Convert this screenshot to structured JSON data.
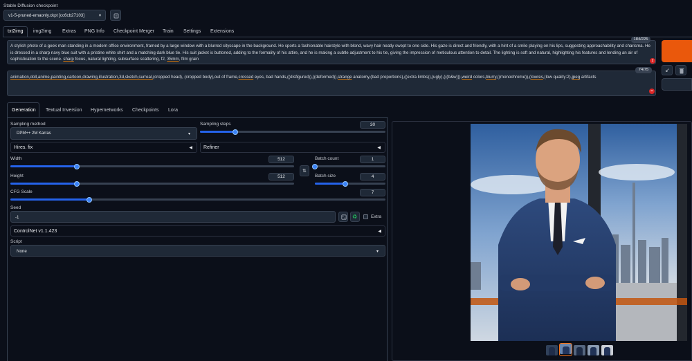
{
  "checkpoint": {
    "label": "Stable Diffusion checkpoint",
    "value": "v1-5-pruned-emaonly.ckpt [cc6cb27103]"
  },
  "tabs": [
    "txt2img",
    "img2img",
    "Extras",
    "PNG Info",
    "Checkpoint Merger",
    "Train",
    "Settings",
    "Extensions"
  ],
  "prompt": {
    "text_parts": [
      {
        "t": "A stylish photo of a geek man standing in a modern office environment, framed by a large window with a blurred cityscape in the background. He sports a fashionable hairstyle with blond, wavy hair neatly swept to one side. His gaze is direct and friendly, with a hint of a smile playing on his lips, suggesting approachability and charisma. He is dressed in a sharp navy blue suit with a pristine white shirt and a matching dark blue tie. His suit jacket is buttoned, adding to the formality of his attire, and he is making a subtle adjustment to his tie, giving the impression of meticulous attention to detail. The lighting is soft and natural, highlighting his features and lending an air of sophistication to the scene. ",
        "u": false
      },
      {
        "t": "sharp",
        "u": true
      },
      {
        "t": " focus, natural lighting, subsurface scattering, f2, ",
        "u": false
      },
      {
        "t": "35mm",
        "u": true
      },
      {
        "t": ", film grain",
        "u": false
      }
    ],
    "token_count": "184/225",
    "badge": "2"
  },
  "negative_prompt": {
    "text_parts": [
      {
        "t": "animation,doll,anime,painting,cartoon,drawing,illustration,3d,sketch,surreal,",
        "u": true
      },
      {
        "t": "(cropped head), (cropped body),out of frame,",
        "u": false
      },
      {
        "t": "crossed",
        "u": true
      },
      {
        "t": " eyes, bad hands,((disfigured)),((deformed)),",
        "u": false
      },
      {
        "t": "strange",
        "u": true
      },
      {
        "t": " anatomy,(bad proportions),((extra limbs)),(ugly),(((b&w))),",
        "u": false
      },
      {
        "t": "weird",
        "u": true
      },
      {
        "t": " colors,",
        "u": false
      },
      {
        "t": "blurry",
        "u": true
      },
      {
        "t": ",((monochrome)),(",
        "u": false
      },
      {
        "t": "lowres",
        "u": true
      },
      {
        "t": ",(low quality:2),",
        "u": false
      },
      {
        "t": "jpeg",
        "u": true
      },
      {
        "t": " artifacts",
        "u": false
      }
    ],
    "token_count": "74/75"
  },
  "subtabs": [
    "Generation",
    "Textual Inversion",
    "Hypernetworks",
    "Checkpoints",
    "Lora"
  ],
  "sampling_method": {
    "label": "Sampling method",
    "value": "DPM++ 2M Karras"
  },
  "sampling_steps": {
    "label": "Sampling steps",
    "value": "30",
    "fraction": 0.19
  },
  "hires_fix": "Hires. fix",
  "refiner": "Refiner",
  "width": {
    "label": "Width",
    "value": "512",
    "fraction": 0.235
  },
  "height": {
    "label": "Height",
    "value": "512",
    "fraction": 0.235
  },
  "batch_count": {
    "label": "Batch count",
    "value": "1",
    "fraction": 0.0
  },
  "batch_size": {
    "label": "Batch size",
    "value": "4",
    "fraction": 0.43
  },
  "cfg_scale": {
    "label": "CFG Scale",
    "value": "7",
    "fraction": 0.21
  },
  "seed": {
    "label": "Seed",
    "value": "-1",
    "extra_label": "Extra"
  },
  "controlnet": "ControlNet v1.1.423",
  "script": {
    "label": "Script",
    "value": "None"
  },
  "colors": {
    "background": "#0b0f19",
    "panel": "#1f2937",
    "accent_slider": "#2563eb",
    "generate_button": "#ea580c"
  }
}
